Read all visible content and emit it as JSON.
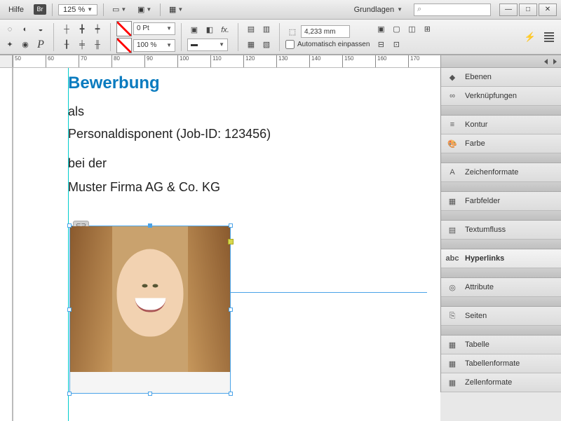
{
  "menubar": {
    "help": "Hilfe",
    "br_badge": "Br",
    "zoom": "125 %",
    "workspace": "Grundlagen",
    "search_placeholder": "⌕"
  },
  "toolbar": {
    "stroke_weight": "0 Pt",
    "opacity": "100 %",
    "frame_width": "4,233 mm",
    "autofit_label": "Automatisch einpassen"
  },
  "ruler": {
    "ticks": [
      "50",
      "60",
      "70",
      "80",
      "90",
      "100",
      "110",
      "120",
      "130",
      "140",
      "150",
      "160",
      "170"
    ]
  },
  "document": {
    "headline": "Bewerbung",
    "line1": "als",
    "line2": "Personaldisponent (Job-ID: 123456)",
    "line3": "bei der",
    "line4": "Muster Firma AG & Co. KG"
  },
  "panels": [
    {
      "label": "Ebenen",
      "icon": "◆"
    },
    {
      "label": "Verknüpfungen",
      "icon": "∞"
    },
    {
      "label": "Kontur",
      "icon": "≡",
      "group_start": true
    },
    {
      "label": "Farbe",
      "icon": "🎨"
    },
    {
      "label": "Zeichenformate",
      "icon": "A",
      "group_start": true
    },
    {
      "label": "Farbfelder",
      "icon": "▦",
      "group_start": true
    },
    {
      "label": "Textumfluss",
      "icon": "▤",
      "group_start": true
    },
    {
      "label": "Hyperlinks",
      "icon": "abc",
      "group_start": true,
      "active": true
    },
    {
      "label": "Attribute",
      "icon": "◎",
      "group_start": true
    },
    {
      "label": "Seiten",
      "icon": "⎘",
      "group_start": true
    },
    {
      "label": "Tabelle",
      "icon": "▦",
      "group_start": true
    },
    {
      "label": "Tabellenformate",
      "icon": "▦"
    },
    {
      "label": "Zellenformate",
      "icon": "▦"
    }
  ]
}
